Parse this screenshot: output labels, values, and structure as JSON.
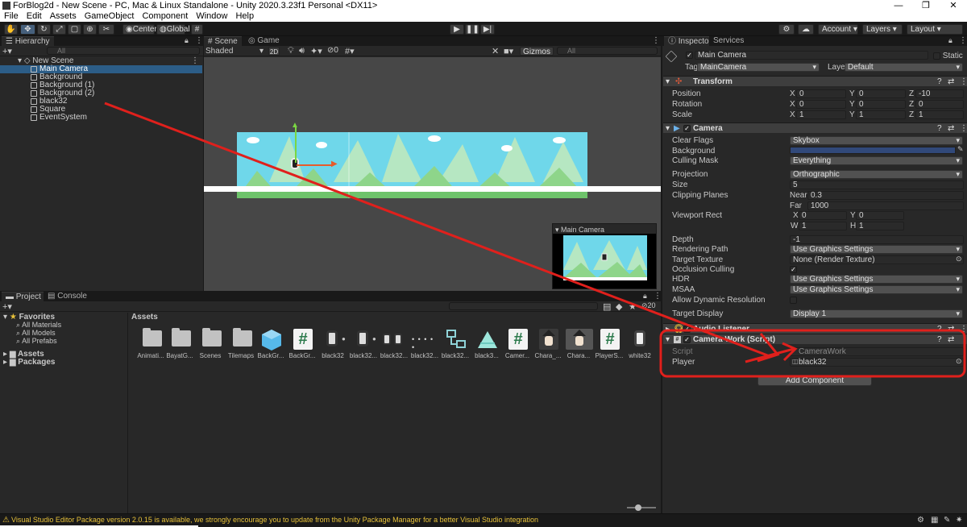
{
  "window": {
    "title": "ForBlog2d - New Scene - PC, Mac & Linux Standalone - Unity 2020.3.23f1 Personal <DX11>",
    "controls": [
      "—",
      "❐",
      "✕"
    ]
  },
  "menu": [
    "File",
    "Edit",
    "Assets",
    "GameObject",
    "Component",
    "Window",
    "Help"
  ],
  "toolbar": {
    "pivot_label": "Center",
    "space_label": "Global",
    "account_label": "Account",
    "layers_label": "Layers",
    "layout_label": "Layout"
  },
  "hierarchy": {
    "tab_label": "Hierarchy",
    "search_placeholder": "All",
    "scene_name": "New Scene",
    "items": [
      "Main Camera",
      "Background",
      "Background (1)",
      "Background (2)",
      "black32",
      "Square",
      "EventSystem"
    ],
    "selected_index": 0
  },
  "scene": {
    "tabs": [
      "Scene",
      "Game"
    ],
    "shading_mode": "Shaded",
    "mode_2d": "2D",
    "gizmos_label": "Gizmos",
    "search_placeholder": "All",
    "hidden_count": "0",
    "camera_preview_title": "Main Camera"
  },
  "project": {
    "tabs": [
      "Project",
      "Console"
    ],
    "favorites_label": "Favorites",
    "favorites": [
      "All Materials",
      "All Models",
      "All Prefabs"
    ],
    "roots": [
      "Assets",
      "Packages"
    ],
    "assets_header": "Assets",
    "hidden_count": "20",
    "assets": [
      "Animati...",
      "BayatG...",
      "Scenes",
      "Tilemaps",
      "BackGr...",
      "BackGr...",
      "black32",
      "black32...",
      "black32...",
      "black32...",
      "black32...",
      "black3...",
      "Camer...",
      "Chara_...",
      "Chara...",
      "PlayerS...",
      "white32"
    ]
  },
  "inspector": {
    "tabs": [
      "Inspector",
      "Services"
    ],
    "object_name": "Main Camera",
    "static_label": "Static",
    "tag_label": "Tag",
    "tag_value": "MainCamera",
    "layer_label": "Layer",
    "layer_value": "Default",
    "transform": {
      "title": "Transform",
      "rows": [
        {
          "label": "Position",
          "x": "0",
          "y": "0",
          "z": "-10"
        },
        {
          "label": "Rotation",
          "x": "0",
          "y": "0",
          "z": "0"
        },
        {
          "label": "Scale",
          "x": "1",
          "y": "1",
          "z": "1"
        }
      ]
    },
    "camera": {
      "title": "Camera",
      "clear_flags_label": "Clear Flags",
      "clear_flags": "Skybox",
      "background_label": "Background",
      "background_color": "#31497a",
      "culling_mask_label": "Culling Mask",
      "culling_mask": "Everything",
      "projection_label": "Projection",
      "projection": "Orthographic",
      "size_label": "Size",
      "size": "5",
      "clipping_label": "Clipping Planes",
      "near_label": "Near",
      "near": "0.3",
      "far_label": "Far",
      "far": "1000",
      "viewport_label": "Viewport Rect",
      "vx_label": "X",
      "vx": "0",
      "vy_label": "Y",
      "vy": "0",
      "vw_label": "W",
      "vw": "1",
      "vh_label": "H",
      "vh": "1",
      "depth_label": "Depth",
      "depth": "-1",
      "rendering_path_label": "Rendering Path",
      "rendering_path": "Use Graphics Settings",
      "target_texture_label": "Target Texture",
      "target_texture": "None (Render Texture)",
      "occlusion_label": "Occlusion Culling",
      "hdr_label": "HDR",
      "hdr": "Use Graphics Settings",
      "msaa_label": "MSAA",
      "msaa": "Use Graphics Settings",
      "dynamic_res_label": "Allow Dynamic Resolution",
      "target_display_label": "Target Display",
      "target_display": "Display 1"
    },
    "audio_listener_title": "Audio Listener",
    "camera_work": {
      "title": "Camera Work (Script)",
      "script_label": "Script",
      "script_value": "CameraWork",
      "player_label": "Player",
      "player_value": "black32"
    },
    "add_component_label": "Add Component"
  },
  "status": {
    "message": "Visual Studio Editor Package version 2.0.15 is available, we strongly encourage you to update from the Unity Package Manager for a better Visual Studio integration"
  },
  "colors": {
    "selection": "#2c5d87",
    "annotation_red": "#e0201c",
    "sky": "#6fd7ea",
    "grass": "#7ed07a"
  }
}
